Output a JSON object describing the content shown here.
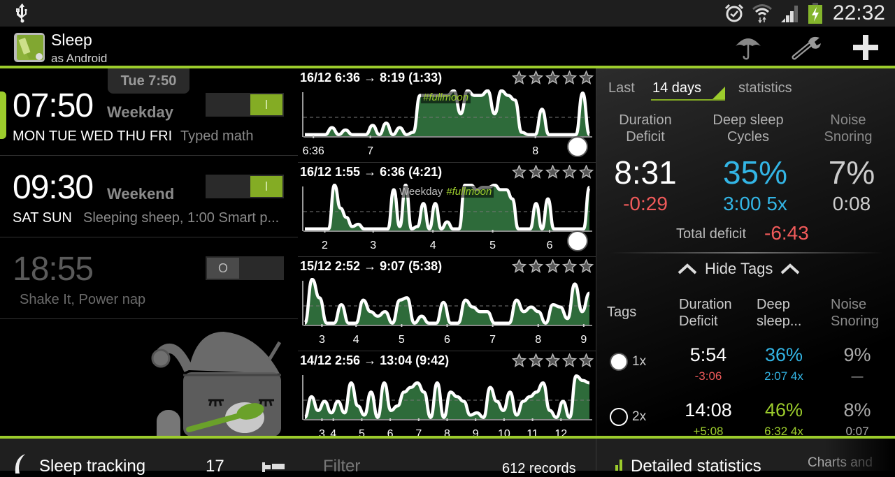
{
  "status_bar": {
    "time": "22:32",
    "icons": [
      "usb-icon",
      "alarm-clock-icon",
      "wifi-icon",
      "signal-icon",
      "battery-charging-icon"
    ],
    "battery_color": "#84b52c"
  },
  "action_bar": {
    "title": "Sleep",
    "subtitle": "as Android",
    "actions": [
      {
        "name": "umbrella-icon",
        "label": "Insurance"
      },
      {
        "name": "wrench-icon",
        "label": "Settings"
      },
      {
        "name": "plus-icon",
        "label": "Add"
      }
    ]
  },
  "accent_color": "#9ccc2c",
  "next_alarm": "Tue 7:50",
  "alarms": [
    {
      "time": "07:50",
      "label": "Weekday",
      "days": "MON TUE WED THU FRI",
      "description": "Typed math",
      "enabled": true,
      "toggle_text": "I",
      "selected": true
    },
    {
      "time": "09:30",
      "label": "Weekend",
      "days": "SAT SUN",
      "description": "Sleeping sheep, 1:00 Smart p...",
      "enabled": true,
      "toggle_text": "I",
      "selected": false
    },
    {
      "time": "18:55",
      "label": "",
      "days": "",
      "description": "Shake It, Power nap",
      "enabled": false,
      "toggle_text": "O",
      "selected": false
    }
  ],
  "records": [
    {
      "title": "16/12 6:36 → 8:19 (1:33)",
      "rating": 0,
      "max_rating": 5,
      "tag_plain": "",
      "tag": "#fullmoon",
      "ticks": [
        {
          "label": "6:36",
          "pos": 0.03
        },
        {
          "label": "7",
          "pos": 0.23
        },
        {
          "label": "8",
          "pos": 0.81
        }
      ],
      "values": [
        0.05,
        0.05,
        0.05,
        0.05,
        0.2,
        0.05,
        0.15,
        0.05,
        0.05,
        0.05,
        0.25,
        0.05,
        0.3,
        0.05,
        0.2,
        0.05,
        0.1,
        0.9,
        0.9,
        0.9,
        0.9,
        0.9,
        1.0,
        0.5,
        1.0,
        0.9,
        0.9,
        1.0,
        0.5,
        1.0,
        0.9,
        0.8,
        0.1,
        0.05,
        0.05,
        0.6,
        0.05,
        0.05,
        0.05,
        0.05,
        0.05,
        0.95,
        0.05
      ],
      "has_end_marker": true
    },
    {
      "title": "16/12 1:55 → 6:36 (4:21)",
      "rating": 0,
      "max_rating": 5,
      "tag_plain": "Weekday",
      "tag": "#fullmoon",
      "ticks": [
        {
          "label": "2",
          "pos": 0.07
        },
        {
          "label": "3",
          "pos": 0.24
        },
        {
          "label": "4",
          "pos": 0.45
        },
        {
          "label": "5",
          "pos": 0.66
        },
        {
          "label": "6",
          "pos": 0.86
        }
      ],
      "values": [
        0.05,
        0.05,
        0.05,
        0.05,
        0.05,
        1.0,
        0.5,
        0.3,
        0.1,
        0.15,
        0.05,
        0.05,
        0.05,
        0.05,
        0.05,
        0.9,
        0.1,
        1.0,
        0.05,
        0.1,
        0.6,
        0.05,
        0.6,
        0.05,
        0.2,
        0.05,
        0.05,
        1.0,
        1.0,
        0.9,
        0.95,
        0.95,
        1.0,
        0.9,
        0.9,
        0.7,
        0.05,
        0.05,
        0.05,
        0.6,
        0.05,
        0.7,
        0.05,
        0.05,
        0.05,
        0.05,
        0.05,
        0.05,
        0.95
      ],
      "has_end_marker": true
    },
    {
      "title": "15/12 2:52 → 9:07 (5:38)",
      "rating": 0,
      "max_rating": 5,
      "tag_plain": "",
      "tag": "",
      "ticks": [
        {
          "label": "3",
          "pos": 0.06
        },
        {
          "label": "4",
          "pos": 0.18
        },
        {
          "label": "5",
          "pos": 0.34
        },
        {
          "label": "6",
          "pos": 0.5
        },
        {
          "label": "7",
          "pos": 0.66
        },
        {
          "label": "8",
          "pos": 0.82
        },
        {
          "label": "9",
          "pos": 0.98
        }
      ],
      "values": [
        0.05,
        1.0,
        0.6,
        0.05,
        0.05,
        0.45,
        0.05,
        0.05,
        0.55,
        0.3,
        0.2,
        0.3,
        0.05,
        0.55,
        0.6,
        0.05,
        0.2,
        0.05,
        0.05,
        0.5,
        0.05,
        0.05,
        0.55,
        0.4,
        0.3,
        0.3,
        0.05,
        0.05,
        0.05,
        0.55,
        0.3,
        0.4,
        0.3,
        0.05,
        0.45,
        0.4,
        0.15,
        0.9,
        0.3,
        0.7
      ],
      "has_end_marker": false
    },
    {
      "title": "14/12 2:56 → 13:04 (9:42)",
      "rating": 0,
      "max_rating": 5,
      "tag_plain": "",
      "tag": "",
      "ticks": [
        {
          "label": "3",
          "pos": 0.06
        },
        {
          "label": "4",
          "pos": 0.1
        },
        {
          "label": "5",
          "pos": 0.2
        },
        {
          "label": "6",
          "pos": 0.3
        },
        {
          "label": "7",
          "pos": 0.4
        },
        {
          "label": "8",
          "pos": 0.5
        },
        {
          "label": "9",
          "pos": 0.6
        },
        {
          "label": "10",
          "pos": 0.7
        },
        {
          "label": "11",
          "pos": 0.8
        },
        {
          "label": "12",
          "pos": 0.9
        }
      ],
      "values": [
        0.05,
        0.5,
        0.2,
        0.4,
        0.15,
        0.4,
        0.15,
        0.8,
        0.3,
        0.1,
        0.6,
        0.05,
        0.8,
        0.2,
        0.3,
        0.6,
        0.7,
        0.8,
        0.6,
        0.05,
        0.8,
        0.05,
        0.6,
        0.5,
        0.4,
        0.1,
        0.15,
        0.05,
        0.7,
        0.4,
        0.2,
        0.6,
        0.1,
        0.4,
        0.5,
        0.6,
        0.8,
        0.2,
        0.05,
        0.4,
        0.05,
        0.95,
        0.85,
        0.8
      ],
      "has_end_marker": false
    }
  ],
  "stats": {
    "prefix": "Last",
    "period": "14 days",
    "suffix": "statistics",
    "columns": [
      {
        "h1": "Duration",
        "h2": "Deficit",
        "big": "8:31",
        "small": "-0:29"
      },
      {
        "h1": "Deep sleep",
        "h2": "Cycles",
        "big": "35%",
        "small": "3:00 5x"
      },
      {
        "h1": "Noise",
        "h2": "Snoring",
        "big": "7%",
        "small": "0:08"
      }
    ],
    "total_deficit_label": "Total deficit",
    "total_deficit_value": "-6:43",
    "hide_tags_label": "Hide Tags",
    "tags_header": {
      "tags": "Tags",
      "c1a": "Duration",
      "c1b": "Deficit",
      "c2a": "Deep",
      "c2b": "sleep...",
      "c3a": "Noise",
      "c3b": "Snoring"
    },
    "tag_rows": [
      {
        "count": "1x",
        "checked": true,
        "duration": "5:54",
        "deficit": "-3:06",
        "deep": "36%",
        "deep_sub": "2:07 4x",
        "noise": "9%",
        "noise_sub": "—"
      },
      {
        "count": "2x",
        "checked": false,
        "duration": "14:08",
        "deficit": "+5:08",
        "deep": "46%",
        "deep_sub": "6:32 4x",
        "noise": "8%",
        "noise_sub": "0:07"
      }
    ]
  },
  "bottom_bar": {
    "sleep_tracking": "Sleep tracking",
    "count": "17",
    "filter": "Filter",
    "records": "612 records",
    "detailed_stats": "Detailed statistics",
    "charts": "Charts and"
  }
}
